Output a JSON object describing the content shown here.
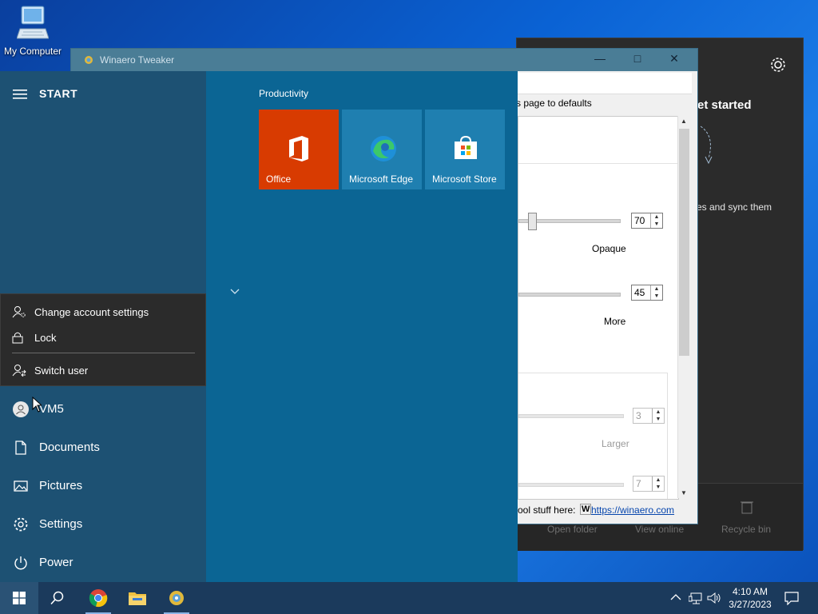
{
  "desktop": {
    "icon_label": "My Computer"
  },
  "onedrive": {
    "title_fragment": "et started",
    "description_fragment": "es and sync them",
    "bottom": [
      "Open folder",
      "View online",
      "Recycle bin"
    ]
  },
  "tweaker": {
    "title": "Winaero Tweaker",
    "reset_text": "s page to defaults",
    "slider1": {
      "value": "70",
      "label": "Opaque"
    },
    "slider2": {
      "value": "45",
      "label": "More"
    },
    "slider3": {
      "value": "3",
      "label": "Larger"
    },
    "slider4": {
      "value": "7"
    },
    "status_text": "ool stuff here:",
    "status_link": "https://winaero.com"
  },
  "start": {
    "title": "START",
    "group_label": "Productivity",
    "tiles": [
      {
        "label": "Office",
        "color": "#d83b01"
      },
      {
        "label": "Microsoft Edge",
        "color": "#1f7fb0"
      },
      {
        "label": "Microsoft Store",
        "color": "#1f7fb0"
      }
    ],
    "account_menu": [
      "Change account settings",
      "Lock",
      "Switch user"
    ],
    "nav": [
      "VM5",
      "Documents",
      "Pictures",
      "Settings",
      "Power"
    ]
  },
  "taskbar": {
    "time": "4:10 AM",
    "date": "3/27/2023"
  }
}
